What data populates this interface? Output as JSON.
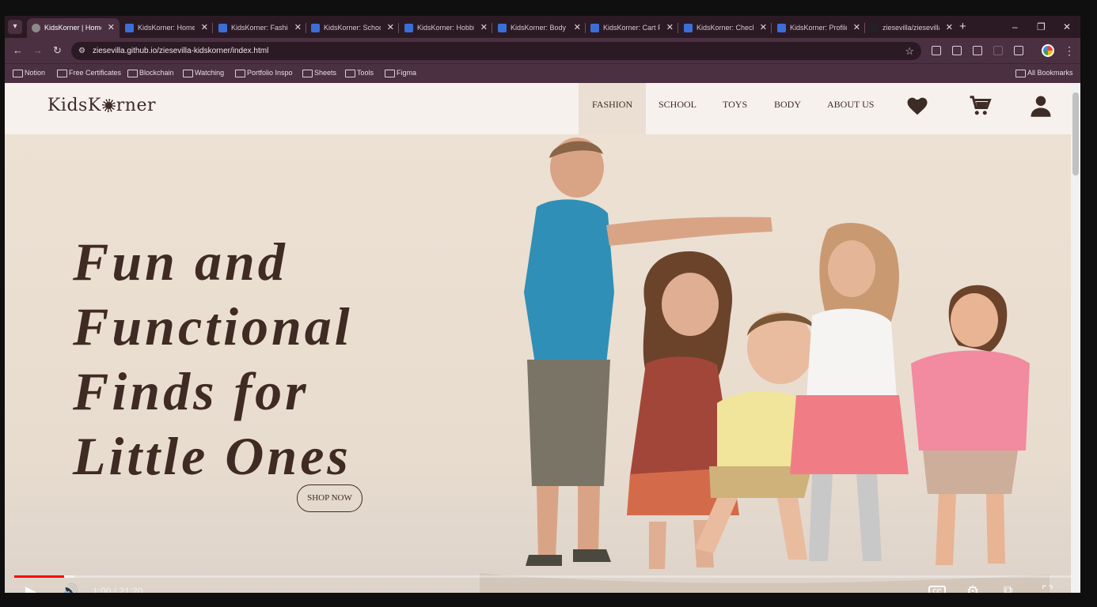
{
  "browser": {
    "tabs": [
      {
        "label": "KidsKorner | Home",
        "active": true
      },
      {
        "label": "KidsKorner: Home"
      },
      {
        "label": "KidsKorner: Fashion"
      },
      {
        "label": "KidsKorner: School"
      },
      {
        "label": "KidsKorner: Hobbies"
      },
      {
        "label": "KidsKorner: Body"
      },
      {
        "label": "KidsKorner: Cart Page"
      },
      {
        "label": "KidsKorner: Checkout"
      },
      {
        "label": "KidsKorner: Profile"
      },
      {
        "label": "ziesevilla/ziesevilla"
      }
    ],
    "url": "ziesevilla.github.io/ziesevilla-kidskorner/index.html",
    "bookmarks": [
      "Notion",
      "Free Certificates",
      "Blockchain",
      "Watching",
      "Portfolio Inspo",
      "Sheets",
      "Tools",
      "Figma"
    ],
    "all_bookmarks": "All Bookmarks"
  },
  "site": {
    "logo_left": "KidsK",
    "logo_right": "rner",
    "nav": [
      "FASHION",
      "SCHOOL",
      "TOYS",
      "BODY",
      "ABOUT US"
    ],
    "headline_lines": [
      "Fun and",
      "Functional",
      "Finds for",
      "Little Ones"
    ],
    "shop_button": "SHOP NOW",
    "icons": [
      "heart-icon",
      "cart-icon",
      "user-icon"
    ],
    "brand_color": "#3f2a24"
  },
  "player": {
    "time": "1:00 / 21:20",
    "progress_fraction": 0.047,
    "cc_label": "CC"
  }
}
